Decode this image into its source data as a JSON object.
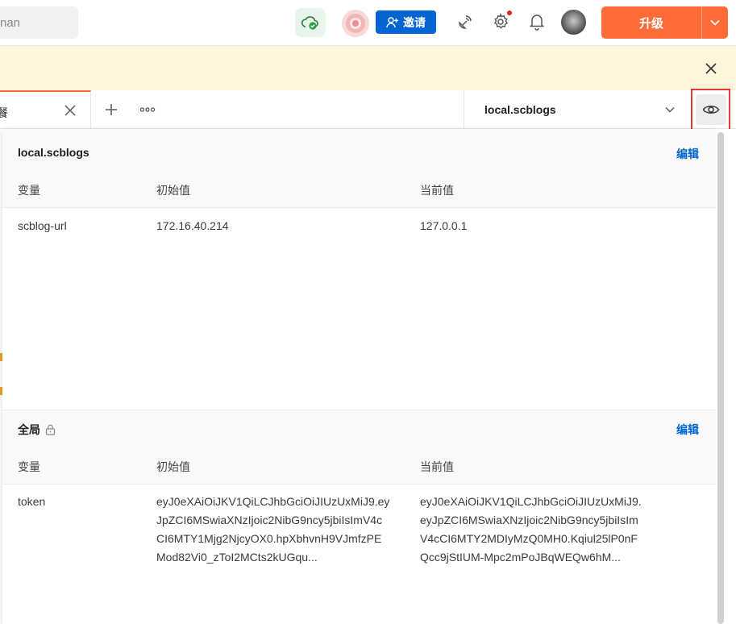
{
  "header": {
    "search_placeholder": "nan",
    "invite_label": "邀请",
    "upgrade_label": "升级"
  },
  "colors": {
    "accent": "#ff6c37",
    "invite_blue": "#0265d2",
    "banner": "#fff4dc",
    "highlight_box": "#e53935"
  },
  "tabs": {
    "active_label": "餐"
  },
  "environment": {
    "selected": "local.scblogs"
  },
  "env_section": {
    "title": "local.scblogs",
    "edit_label": "编辑",
    "columns": [
      "变量",
      "初始值",
      "当前值"
    ],
    "rows": [
      {
        "variable": "scblog-url",
        "initial": "172.16.40.214",
        "current": "127.0.0.1"
      }
    ]
  },
  "global_section": {
    "title": "全局",
    "edit_label": "编辑",
    "columns": [
      "变量",
      "初始值",
      "当前值"
    ],
    "rows": [
      {
        "variable": "token",
        "initial_lines": [
          "eyJ0eXAiOiJKV1QiLCJhbGciOiJIUzUxMiJ9.ey",
          "JpZCI6MSwiaXNzIjoic2NibG9ncy5jbiIsImV4c",
          "CI6MTY1Mjg2NjcyOX0.hpXbhvnH9VJmfzPE",
          "Mod82Vi0_zToI2MCts2kUGqu..."
        ],
        "current_lines": [
          "eyJ0eXAiOiJKV1QiLCJhbGciOiJIUzUxMiJ9.",
          "eyJpZCI6MSwiaXNzIjoic2NibG9ncy5jbiIsIm",
          "V4cCI6MTY2MDIyMzQ0MH0.Kqiul25lP0nF",
          "Qcc9jStIUM-Mpc2mPoJBqWEQw6hM..."
        ]
      }
    ]
  }
}
